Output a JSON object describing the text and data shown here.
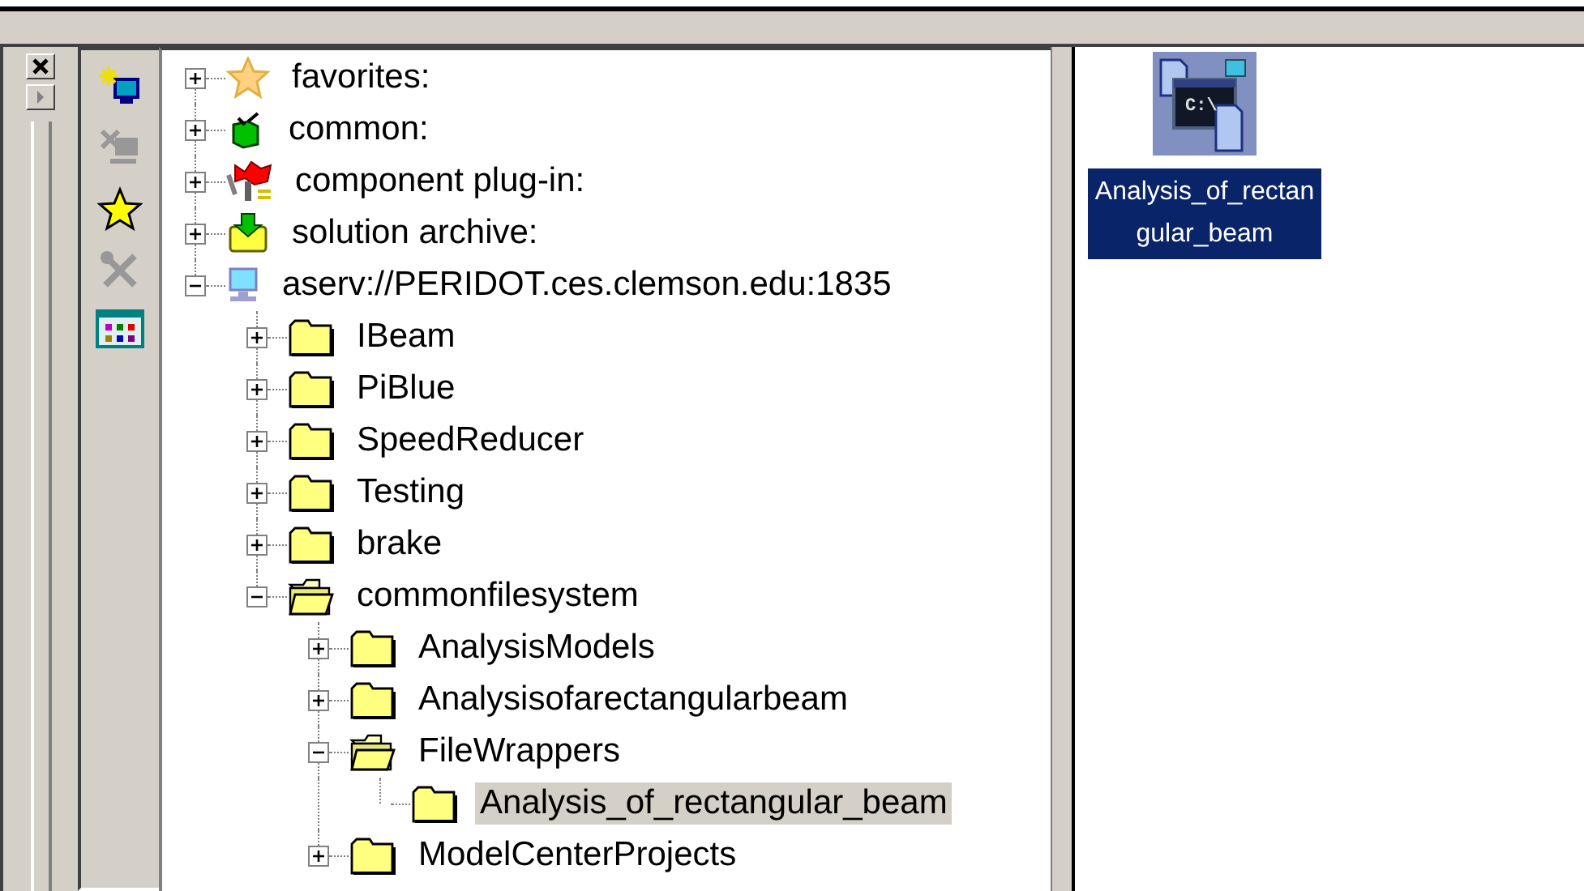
{
  "toolbar": [
    {
      "kind": "add-server",
      "disabled": false
    },
    {
      "kind": "remove-server",
      "disabled": true
    },
    {
      "kind": "favorite",
      "disabled": false
    },
    {
      "kind": "tools",
      "disabled": true
    },
    {
      "kind": "palette",
      "disabled": false
    }
  ],
  "tree": [
    {
      "label": "favorites:",
      "kind": "star",
      "expanded": false,
      "selected": false
    },
    {
      "label": "common:",
      "kind": "cube",
      "expanded": false,
      "selected": false
    },
    {
      "label": "component plug-in:",
      "kind": "plugin",
      "expanded": false,
      "selected": false
    },
    {
      "label": "solution archive:",
      "kind": "archive",
      "expanded": false,
      "selected": false
    },
    {
      "label": "aserv://PERIDOT.ces.clemson.edu:1835",
      "kind": "server",
      "expanded": true,
      "selected": false,
      "children": [
        {
          "label": "IBeam",
          "kind": "folder",
          "expanded": false,
          "selected": false
        },
        {
          "label": "PiBlue",
          "kind": "folder",
          "expanded": false,
          "selected": false
        },
        {
          "label": "SpeedReducer",
          "kind": "folder",
          "expanded": false,
          "selected": false
        },
        {
          "label": "Testing",
          "kind": "folder",
          "expanded": false,
          "selected": false
        },
        {
          "label": "brake",
          "kind": "folder",
          "expanded": false,
          "selected": false
        },
        {
          "label": "commonfilesystem",
          "kind": "folder",
          "expanded": true,
          "selected": false,
          "children": [
            {
              "label": "AnalysisModels",
              "kind": "folder",
              "expanded": false,
              "selected": false
            },
            {
              "label": "Analysisofarectangularbeam",
              "kind": "folder",
              "expanded": false,
              "selected": false
            },
            {
              "label": "FileWrappers",
              "kind": "folder",
              "expanded": true,
              "selected": false,
              "children": [
                {
                  "label": "Analysis_of_rectangular_beam",
                  "kind": "folder",
                  "selected": true
                }
              ]
            },
            {
              "label": "ModelCenterProjects",
              "kind": "folder",
              "expanded": false,
              "selected": false
            }
          ]
        }
      ]
    }
  ],
  "files": [
    {
      "label": "Analysis_of_rectangular_beam",
      "icon_text": "C:\\",
      "selected": true
    }
  ]
}
